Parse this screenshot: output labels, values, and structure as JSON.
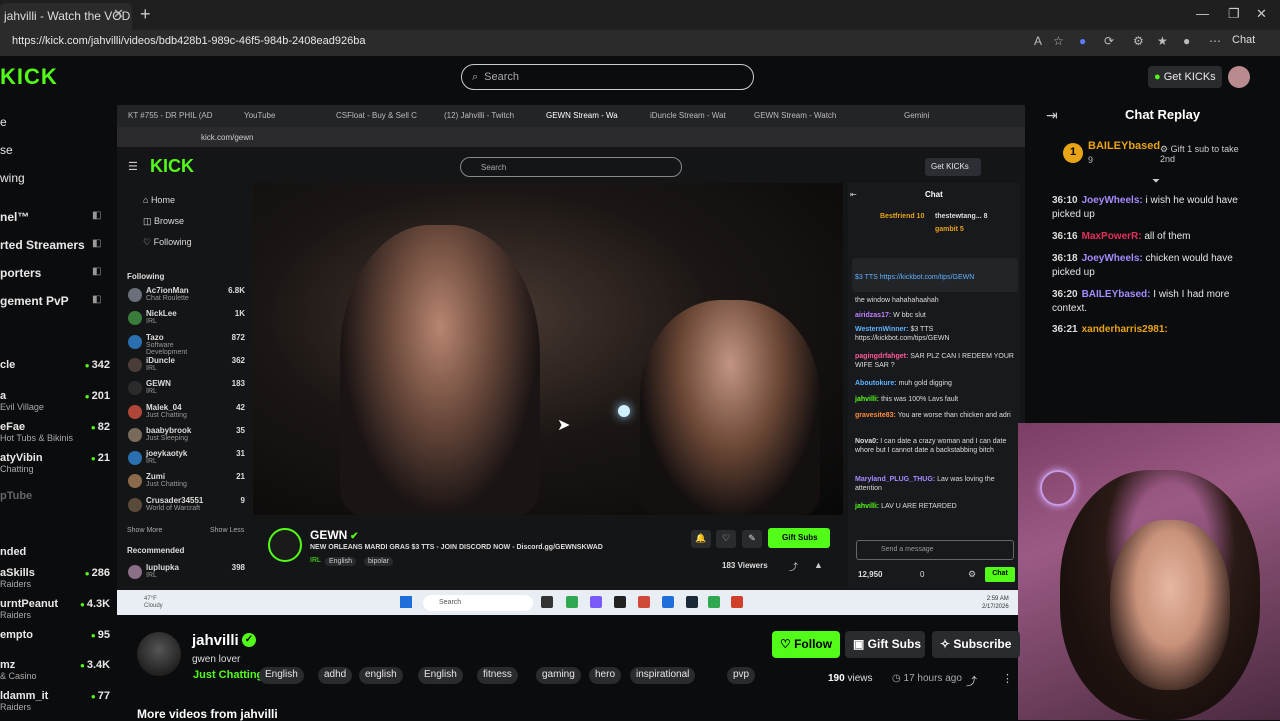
{
  "browser": {
    "tab_title": "jahvilli - Watch the VOD on K",
    "url": "https://kick.com/jahvilli/videos/bdb428b1-989c-46f5-984b-2408ead926ba",
    "chat_label": "Chat"
  },
  "header": {
    "logo": "KICK",
    "search_placeholder": "Search",
    "get_kicks": "Get KICKs"
  },
  "left_nav": {
    "items": [
      "e",
      "se",
      "wing"
    ],
    "sections": [
      {
        "label": "nel™"
      },
      {
        "label": "rted Streamers"
      },
      {
        "label": "porters"
      },
      {
        "label": "gement PvP"
      }
    ],
    "channels": [
      {
        "name": "cle",
        "sub": "",
        "count": "342"
      },
      {
        "name": "a",
        "sub": "Evil Village",
        "count": "201"
      },
      {
        "name": "eFae",
        "sub": "Hot Tubs & Bikinis",
        "count": "82"
      },
      {
        "name": "atyVibin",
        "sub": "Chatting",
        "count": "21"
      },
      {
        "name": "pTube",
        "sub": "",
        "count": ""
      }
    ],
    "recommended_label": "nded",
    "recommended": [
      {
        "name": "aSkills",
        "sub": "Raiders",
        "count": "286"
      },
      {
        "name": "urntPeanut",
        "sub": "Raiders",
        "count": "4.3K"
      },
      {
        "name": "empto",
        "sub": "",
        "count": "95"
      },
      {
        "name": "mz",
        "sub": "& Casino",
        "count": "3.4K"
      },
      {
        "name": "ldamm_it",
        "sub": "Raiders",
        "count": "77"
      }
    ]
  },
  "embedded": {
    "tabs": [
      "KT #755 - DR PHIL (AD",
      "YouTube",
      "CSFloat - Buy & Sell C",
      "(12) Jahvilli - Twitch",
      "GEWN Stream - Wa",
      "iDuncle Stream - Wat",
      "GEWN Stream - Watch",
      "Gemini"
    ],
    "url": "kick.com/gewn",
    "logo": "KICK",
    "search": "Search",
    "get_kicks": "Get KICKs",
    "nav": [
      "Home",
      "Browse",
      "Following"
    ],
    "following_label": "Following",
    "following": [
      {
        "name": "Ac7ionMan",
        "sub": "Chat Roulette",
        "count": "6.8K"
      },
      {
        "name": "NickLee",
        "sub": "IRL",
        "count": "1K"
      },
      {
        "name": "Tazo",
        "sub": "Software Development",
        "count": "872"
      },
      {
        "name": "iDuncle",
        "sub": "IRL",
        "count": "362"
      },
      {
        "name": "GEWN",
        "sub": "IRL",
        "count": "183"
      },
      {
        "name": "Malek_04",
        "sub": "Just Chatting",
        "count": "42"
      },
      {
        "name": "baabybrook",
        "sub": "Just Sleeping",
        "count": "35"
      },
      {
        "name": "joeykaotyk",
        "sub": "IRL",
        "count": "31"
      },
      {
        "name": "Zumi",
        "sub": "Just Chatting",
        "count": "21"
      },
      {
        "name": "Crusader34551",
        "sub": "World of Warcraft",
        "count": "9"
      }
    ],
    "show_more": "Show More",
    "show_less": "Show Less",
    "recommended_label": "Recommended",
    "recommended": [
      {
        "name": "luplupka",
        "sub": "IRL",
        "count": "398"
      }
    ],
    "stream": {
      "name": "GEWN",
      "title": "NEW ORLEANS MARDI GRAS $3 TTS - JOIN DISCORD NOW - Discord.gg/GEWNSKWAD",
      "category": "IRL",
      "tags": [
        "English",
        "bipolar"
      ],
      "gift_subs": "Gift Subs",
      "viewers": "183 Viewers"
    },
    "chat": {
      "title": "Chat",
      "top_gifters": [
        "Bestfriend 10",
        "thestewtang... 8",
        "gambit 5"
      ],
      "pinned": "$3 TTS https://kickbot.com/tips/GEWN",
      "messages": [
        {
          "user": "",
          "text": "the window hahahahaahah"
        },
        {
          "user": "airidzas17:",
          "text": "W bbc slut"
        },
        {
          "user": "WesternWinner:",
          "text": "$3 TTS https://kickbot.com/tips/GEWN"
        },
        {
          "user": "pagingdrfahget:",
          "text": "SAR PLZ CAN I REDEEM YOUR WIFE SAR ?"
        },
        {
          "user": "Aboutokure:",
          "text": "muh gold digging"
        },
        {
          "user": "jahvilli:",
          "text": "this was 100% Lavs fault"
        },
        {
          "user": "gravesite83:",
          "text": "You are worse than chicken and adri"
        },
        {
          "user": "Nova0:",
          "text": "I can date a crazy woman and I can date whore but I cannot date a backstabbing bitch"
        },
        {
          "user": "Maryland_PLUG_THUG:",
          "text": "Lav was loving the attention"
        },
        {
          "user": "jahvilli:",
          "text": "LAV U ARE RETARDED"
        }
      ],
      "send_placeholder": "Send a message",
      "points": "12,950",
      "count": "0",
      "chat_button": "Chat"
    },
    "taskbar": {
      "weather_temp": "47°F",
      "weather_desc": "Cloudy",
      "search": "Search",
      "time": "2:59 AM",
      "date": "2/17/2026"
    }
  },
  "chat_replay": {
    "title": "Chat Replay",
    "pinned_user": "BAILEYbased",
    "pinned_badge": "1",
    "pinned_count": "9",
    "pinned_gift": "Gift 1 sub to take 2nd",
    "messages": [
      {
        "ts": "36:10",
        "user": "JoeyWheels:",
        "color": "#a58bff",
        "text": "i wish he would have picked up"
      },
      {
        "ts": "36:16",
        "user": "MaxPowerR:",
        "color": "#e0315a",
        "text": "all of them"
      },
      {
        "ts": "36:18",
        "user": "JoeyWheels:",
        "color": "#a58bff",
        "text": "chicken would have picked up"
      },
      {
        "ts": "36:20",
        "user": "BAILEYbased:",
        "color": "#a58bff",
        "text": "I wish I had more context."
      },
      {
        "ts": "36:21",
        "user": "xanderharris2981:",
        "color": "#e8a317",
        "text": ""
      }
    ]
  },
  "channel": {
    "name": "jahvilli",
    "bio": "gwen lover",
    "category": "Just Chatting",
    "tags": [
      "English",
      "adhd",
      "english",
      "English",
      "fitness",
      "gaming",
      "hero",
      "inspirational",
      "pvp"
    ],
    "follow": "Follow",
    "gift_subs": "Gift Subs",
    "subscribe": "Subscribe",
    "views_count": "190",
    "views_label": "views",
    "ago": "17 hours ago",
    "more_videos": "More videos from jahvilli"
  },
  "colors": {
    "accent": "#53fc18",
    "bg": "#0b0c0e"
  }
}
